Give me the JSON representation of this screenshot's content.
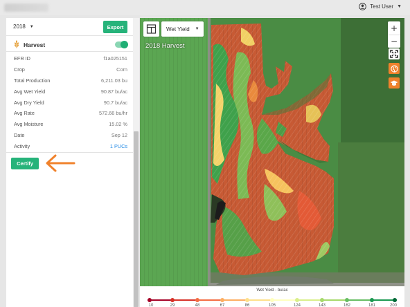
{
  "header": {
    "user_name": "Test User",
    "user_icon": "user-circle-icon",
    "caret": "▼"
  },
  "panel": {
    "year": "2018",
    "export_label": "Export",
    "harvest_title": "Harvest",
    "harvest_enabled": true,
    "info": [
      {
        "label": "EFR ID",
        "value": "f1a025151"
      },
      {
        "label": "Crop",
        "value": "Corn"
      },
      {
        "label": "Total Production",
        "value": "6,211.03 bu"
      },
      {
        "label": "Avg Wet Yield",
        "value": "90.87 bu/ac"
      },
      {
        "label": "Avg Dry Yield",
        "value": "90.7 bu/ac"
      },
      {
        "label": "Avg Rate",
        "value": "572.66 bu/hr"
      },
      {
        "label": "Avg Moisture",
        "value": "15.02 %"
      },
      {
        "label": "Date",
        "value": "Sep 12"
      },
      {
        "label": "Activity",
        "value": "1 PUCs",
        "link": true
      }
    ],
    "certify_label": "Certify",
    "colors": {
      "accent": "#26b37a",
      "arrow": "#f0822c",
      "link": "#1e88e5"
    }
  },
  "map": {
    "title": "2018 Harvest",
    "layer": "Wet Yield",
    "zoom_in": "+",
    "zoom_out": "−",
    "icons": [
      "layout-icon",
      "expand-icon",
      "globe-icon",
      "graduation-cap-icon"
    ]
  },
  "legend": {
    "title": "Wet Yield - bu/ac",
    "ticks": [
      "10",
      "29",
      "48",
      "67",
      "86",
      "105",
      "124",
      "143",
      "162",
      "181",
      "200"
    ],
    "colors": [
      "#a50026",
      "#d73027",
      "#f46d43",
      "#fdae61",
      "#fee08b",
      "#ffffbf",
      "#d9ef8b",
      "#a6d96a",
      "#66bd63",
      "#1a9850",
      "#006837"
    ]
  }
}
